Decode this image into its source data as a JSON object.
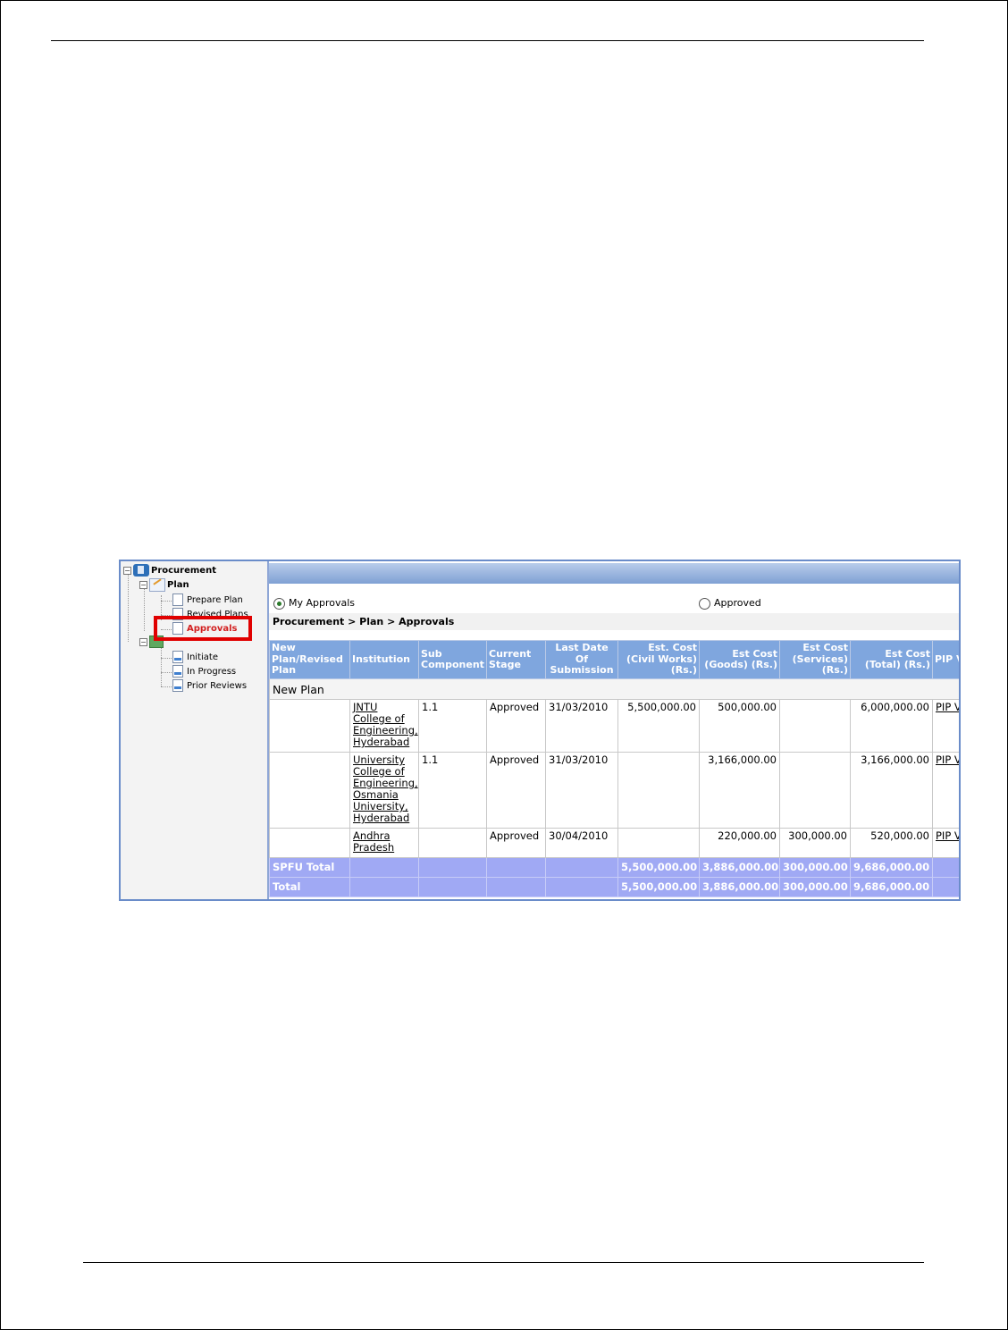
{
  "tree": {
    "root": "Procurement",
    "plan": "Plan",
    "plan_items": [
      "Prepare Plan",
      "Revised Plans",
      "Approvals"
    ],
    "review_items": [
      "Initiate",
      "In Progress",
      "Prior Reviews"
    ]
  },
  "filters": {
    "my_approvals": "My Approvals",
    "approved": "Approved"
  },
  "breadcrumb": "Procurement > Plan > Approvals",
  "table": {
    "headers": [
      "New Plan/Revised Plan",
      "Institution",
      "Sub Component",
      "Current Stage",
      "Last Date Of Submission",
      "Est. Cost (Civil Works) (Rs.)",
      "Est Cost (Goods) (Rs.)",
      "Est Cost (Services) (Rs.)",
      "Est Cost (Total) (Rs.)",
      "PIP V"
    ],
    "group_label": "New Plan",
    "rows": [
      {
        "institution": "JNTU College of Engineering, Hyderabad",
        "sub": "1.1",
        "stage": "Approved",
        "date": "31/03/2010",
        "civil": "5,500,000.00",
        "goods": "500,000.00",
        "services": "",
        "total": "6,000,000.00",
        "pip": "PIP V"
      },
      {
        "institution": "University College of Engineering, Osmania University, Hyderabad",
        "sub": "1.1",
        "stage": "Approved",
        "date": "31/03/2010",
        "civil": "",
        "goods": "3,166,000.00",
        "services": "",
        "total": "3,166,000.00",
        "pip": "PIP V"
      },
      {
        "institution": "Andhra Pradesh",
        "sub": "",
        "stage": "Approved",
        "date": "30/04/2010",
        "civil": "",
        "goods": "220,000.00",
        "services": "300,000.00",
        "total": "520,000.00",
        "pip": "PIP V"
      }
    ],
    "totals": [
      {
        "label": "SPFU Total",
        "civil": "5,500,000.00",
        "goods": "3,886,000.00",
        "services": "300,000.00",
        "total": "9,686,000.00"
      },
      {
        "label": "Total",
        "civil": "5,500,000.00",
        "goods": "3,886,000.00",
        "services": "300,000.00",
        "total": "9,686,000.00"
      }
    ]
  }
}
